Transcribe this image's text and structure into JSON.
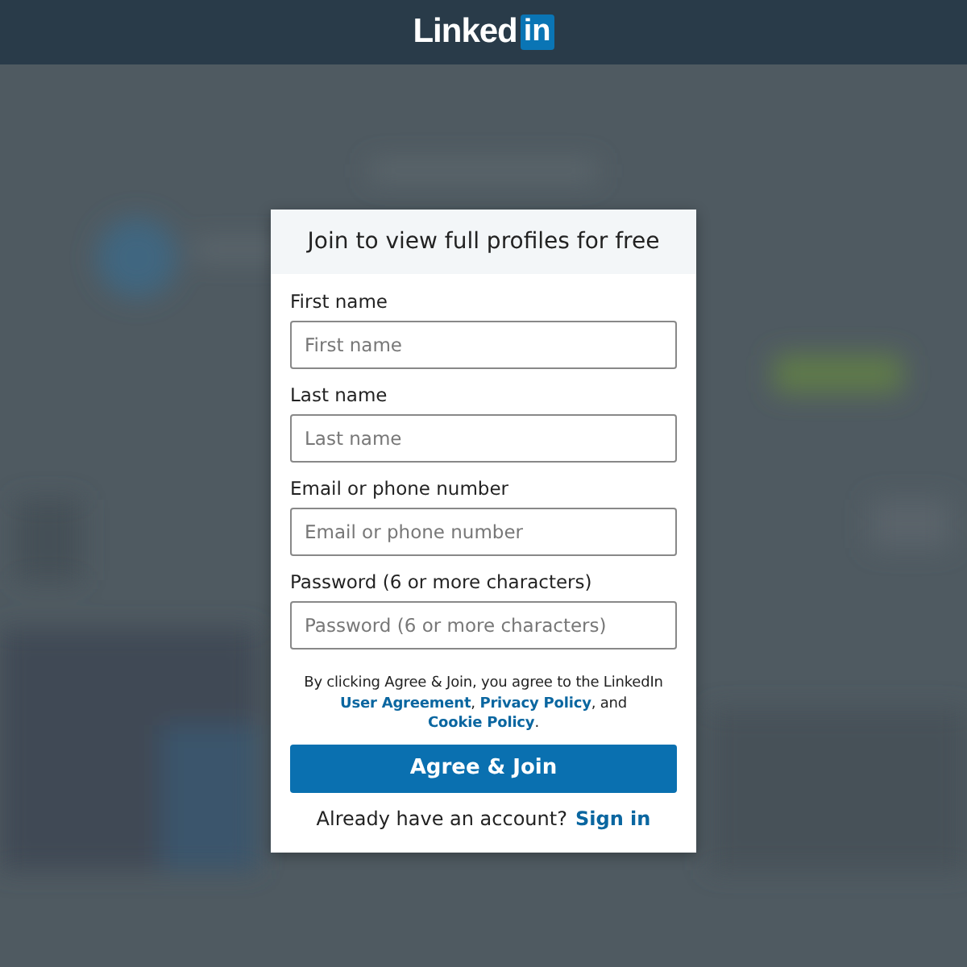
{
  "header": {
    "logo_word": "Linked",
    "logo_badge": "in"
  },
  "dialog": {
    "title": "Join to view full profiles for free",
    "fields": [
      {
        "label": "First name",
        "placeholder": "First name"
      },
      {
        "label": "Last name",
        "placeholder": "Last name"
      },
      {
        "label": "Email or phone number",
        "placeholder": "Email or phone number"
      },
      {
        "label": "Password (6 or more characters)",
        "placeholder": "Password (6 or more characters)"
      }
    ],
    "consent": {
      "lead": "By clicking Agree & Join, you agree to the LinkedIn",
      "links": [
        "User Agreement",
        "Privacy Policy",
        "Cookie Policy"
      ],
      "joiners": [
        ", ",
        ", and ",
        "."
      ]
    },
    "submit": "Agree & Join",
    "signin": {
      "prompt": "Already have an account?",
      "link": "Sign in"
    }
  }
}
